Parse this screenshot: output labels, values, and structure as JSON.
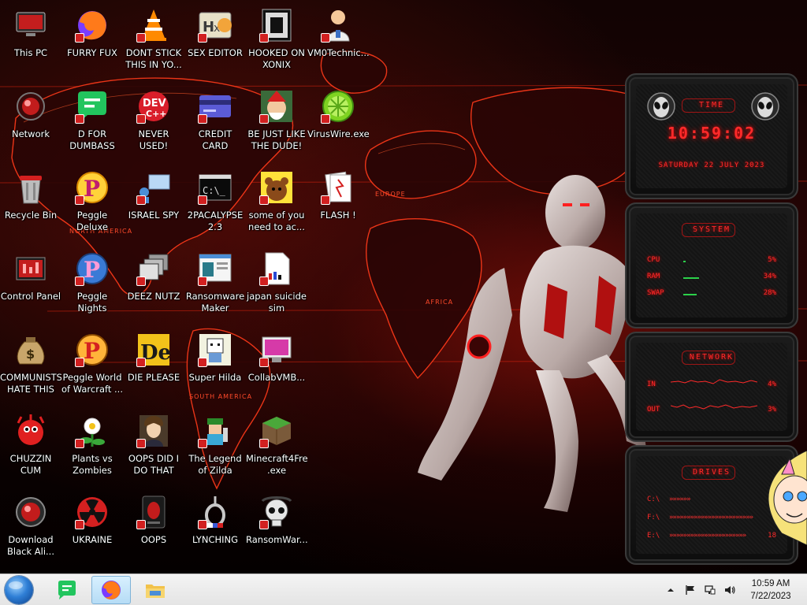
{
  "desktop": {
    "icons": [
      {
        "label": "This PC",
        "icon": "computer-icon",
        "col": 0,
        "row": 0
      },
      {
        "label": "FURRY FUX",
        "icon": "firefox-icon",
        "col": 1,
        "row": 0
      },
      {
        "label": "DONT STICK THIS IN YO...",
        "icon": "vlc-cone-icon",
        "col": 2,
        "row": 0
      },
      {
        "label": "SEX EDITOR",
        "icon": "hxd-editor-icon",
        "col": 3,
        "row": 0
      },
      {
        "label": "HOOKED ON XONIX",
        "icon": "xonix-game-icon",
        "col": 4,
        "row": 0
      },
      {
        "label": "VM0Technic...",
        "icon": "doctor-icon",
        "col": 5,
        "row": 0
      },
      {
        "label": "Network",
        "icon": "network-icon",
        "col": 0,
        "row": 1
      },
      {
        "label": "D FOR DUMBASS",
        "icon": "discord-chat-icon",
        "col": 1,
        "row": 1
      },
      {
        "label": "NEVER USED!",
        "icon": "devcpp-icon",
        "col": 2,
        "row": 1
      },
      {
        "label": "CREDIT CARD CHECKER",
        "icon": "credit-card-icon",
        "col": 3,
        "row": 1
      },
      {
        "label": "BE JUST LIKE THE DUDE!",
        "icon": "santa-elf-icon",
        "col": 4,
        "row": 1
      },
      {
        "label": "VirusWire.exe",
        "icon": "limewire-icon",
        "col": 5,
        "row": 1
      },
      {
        "label": "Recycle Bin",
        "icon": "recycle-bin-icon",
        "col": 0,
        "row": 2
      },
      {
        "label": "Peggle Deluxe",
        "icon": "peggle-icon",
        "col": 1,
        "row": 2
      },
      {
        "label": "ISRAEL SPY",
        "icon": "remote-desktop-icon",
        "col": 2,
        "row": 2
      },
      {
        "label": "2PACALYPSE 2.3",
        "icon": "terminal-icon",
        "col": 3,
        "row": 2
      },
      {
        "label": "some of you need to ac...",
        "icon": "bear-icon",
        "col": 4,
        "row": 2
      },
      {
        "label": "FLASH !",
        "icon": "flash-cards-icon",
        "col": 5,
        "row": 2
      },
      {
        "label": "Control Panel",
        "icon": "control-panel-icon",
        "col": 0,
        "row": 3
      },
      {
        "label": "Peggle Nights Deluxe",
        "icon": "peggle-nights-icon",
        "col": 1,
        "row": 3
      },
      {
        "label": "DEEZ NUTZ",
        "icon": "stacked-windows-icon",
        "col": 2,
        "row": 3
      },
      {
        "label": "Ransomware Maker Build...",
        "icon": "window-app-icon",
        "col": 3,
        "row": 3
      },
      {
        "label": "japan suicide sim",
        "icon": "document-icon",
        "col": 4,
        "row": 3
      },
      {
        "label": "COMMUNISTS HATE THIS G...",
        "icon": "money-bag-icon",
        "col": 0,
        "row": 4
      },
      {
        "label": "Peggle World of Warcraft ...",
        "icon": "peggle-wow-icon",
        "col": 1,
        "row": 4
      },
      {
        "label": "DIE PLEASE",
        "icon": "die-logo-icon",
        "col": 2,
        "row": 4
      },
      {
        "label": "Super Hilda",
        "icon": "pixel-character-icon",
        "col": 3,
        "row": 4
      },
      {
        "label": "CollabVMB...",
        "icon": "monitor-icon",
        "col": 4,
        "row": 4
      },
      {
        "label": "CHUZZIN CUM",
        "icon": "chuzzle-icon",
        "col": 0,
        "row": 5
      },
      {
        "label": "Plants vs Zombies",
        "icon": "plant-icon",
        "col": 1,
        "row": 5
      },
      {
        "label": "OOPS DID I DO THAT",
        "icon": "portrait-icon",
        "col": 2,
        "row": 5
      },
      {
        "label": "The Legend of Zilda",
        "icon": "pixel-hero-icon",
        "col": 3,
        "row": 5
      },
      {
        "label": "Minecraft4Free .exe",
        "icon": "grass-block-icon",
        "col": 4,
        "row": 5
      },
      {
        "label": "Download Black Ali...",
        "icon": "alien-orb-icon",
        "col": 0,
        "row": 6
      },
      {
        "label": "UKRAINE",
        "icon": "radiation-icon",
        "col": 1,
        "row": 6
      },
      {
        "label": "OOPS",
        "icon": "alien-tablet-icon",
        "col": 2,
        "row": 6
      },
      {
        "label": "LYNCHING",
        "icon": "noose-icon",
        "col": 3,
        "row": 6
      },
      {
        "label": "RansomWar...",
        "icon": "skull-icon",
        "col": 4,
        "row": 6
      }
    ]
  },
  "wallpaper": {
    "map_labels": [
      "NORTH AMERICA",
      "EUROPE",
      "AFRICA",
      "SOUTH AMERICA"
    ]
  },
  "gadgets": {
    "clock": {
      "title": "TIME",
      "time": "10:59:02",
      "date": "SATURDAY 22 JULY 2023"
    },
    "system": {
      "title": "SYSTEM",
      "rows": [
        {
          "name": "CPU",
          "value": "5%",
          "percent": 5
        },
        {
          "name": "RAM",
          "value": "34%",
          "percent": 34
        },
        {
          "name": "SWAP",
          "value": "28%",
          "percent": 28
        }
      ]
    },
    "network": {
      "title": "NETWORK",
      "rows": [
        {
          "name": "IN",
          "value": "4%"
        },
        {
          "name": "OUT",
          "value": "3%"
        }
      ]
    },
    "drives": {
      "title": "DRIVES",
      "rows": [
        {
          "name": "C:\\",
          "chevrons": "»»»»»»",
          "value": ""
        },
        {
          "name": "F:\\",
          "chevrons": "»»»»»»»»»»»»»»»»»»»»»»»»",
          "value": ""
        },
        {
          "name": "E:\\",
          "chevrons": "»»»»»»»»»»»»»»»»»»»»»»",
          "value": "18"
        }
      ]
    }
  },
  "taskbar": {
    "pinned": [
      {
        "icon": "start-orb-icon"
      },
      {
        "icon": "discord-chat-icon"
      },
      {
        "icon": "firefox-icon",
        "active": true
      },
      {
        "icon": "file-explorer-icon"
      }
    ],
    "tray_icons": [
      "chevron-up-icon",
      "flag-icon",
      "network-tray-icon",
      "volume-icon"
    ],
    "clock": {
      "time": "10:59 AM",
      "date": "7/22/2023"
    }
  }
}
